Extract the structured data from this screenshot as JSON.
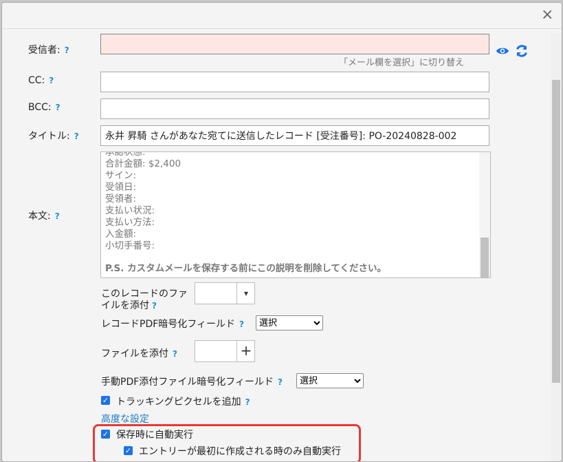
{
  "dialog": {
    "close_glyph": "×"
  },
  "fields": {
    "to": {
      "label": "受信者:",
      "value": ""
    },
    "switch_text": "「メール欄を選択」に切り替え",
    "cc": {
      "label": "CC:",
      "value": ""
    },
    "bcc": {
      "label": "BCC:",
      "value": ""
    },
    "title": {
      "label": "タイトル:",
      "value": "永井 昇騎 さんがあなた宛てに送信したレコード [受注番号]: PO-20240828-002"
    },
    "body": {
      "label": "本文:",
      "lines": [
        "承認状態:",
        "合計金額: $2,400",
        "サイン:",
        "受領日:",
        "受領者:",
        "支払い状況:",
        "支払い方法:",
        "入金額:",
        "小切手番号:"
      ],
      "ps": "P.S. カスタムメールを保存する前にこの説明を削除してください。"
    }
  },
  "help_glyph": "?",
  "attach_record": {
    "label_line1": "このレコードのファ",
    "label_line2": "イルを添付",
    "button_glyph": "▾"
  },
  "record_pdf": {
    "label": "レコードPDF暗号化フィールド",
    "selected": "選択"
  },
  "attach_file": {
    "label": "ファイルを添付",
    "button_glyph": "+"
  },
  "manual_pdf": {
    "label": "手動PDF添付ファイル暗号化フィールド",
    "selected": "選択"
  },
  "tracking": {
    "label": "トラッキングピクセルを追加",
    "checked": true
  },
  "advanced_link": "高度な設定",
  "auto_run": {
    "label": "保存時に自動実行",
    "checked": true
  },
  "first_only": {
    "label": "エントリーが最初に作成される時のみ自動実行",
    "checked": true
  },
  "colors": {
    "accent": "#1a8fd6",
    "to_bg": "#fde7e4",
    "highlight": "#e53935"
  }
}
